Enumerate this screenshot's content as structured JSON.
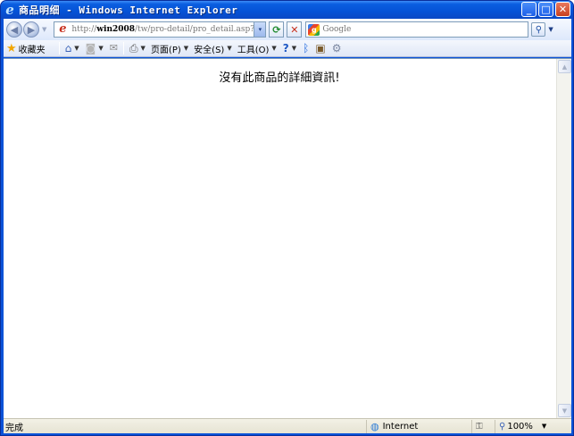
{
  "window": {
    "title": "商品明细 - Windows Internet Explorer",
    "accent": "#0a52d8"
  },
  "address_bar": {
    "url_prefix": "http://",
    "url_host": "win2008",
    "url_path": "/tw/pro-detail/pro_detail.asp?Cur",
    "page_icon": "page-icon",
    "dropdown_glyph": "▾"
  },
  "nav": {
    "back_icon": "back-arrow-icon",
    "forward_icon": "forward-arrow-icon",
    "refresh_icon": "refresh-icon",
    "stop_icon": "stop-icon"
  },
  "search": {
    "placeholder": "Google",
    "engine_icon": "google-icon",
    "go_icon": "magnifier-icon"
  },
  "command_bar": {
    "favorites_label": "收藏夹",
    "page_label": "页面(P)",
    "safety_label": "安全(S)",
    "tools_label": "工具(O)"
  },
  "content": {
    "message": "沒有此商品的詳細資訊!"
  },
  "status_bar": {
    "status_text": "完成",
    "zone_label": "Internet",
    "zoom_label": "100%"
  }
}
